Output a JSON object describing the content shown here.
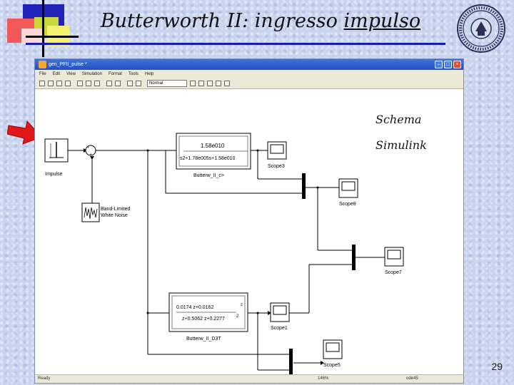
{
  "slide": {
    "title_prefix": "Butterworth II: ingresso ",
    "title_underlined": "impulso",
    "page_number": "29",
    "annotation_line1": "Schema",
    "annotation_line2": "Simulink"
  },
  "window": {
    "title": "gen_PFII_pulse *",
    "menu": [
      "File",
      "Edit",
      "View",
      "Simulation",
      "Format",
      "Tools",
      "Help"
    ],
    "mode_select": "Normal",
    "status": {
      "left": "Ready",
      "zoom": "146%",
      "solver": "ode45"
    }
  },
  "blocks": {
    "impulse": "Impulse",
    "noise_line1": "Band-Limited",
    "noise_line2": "White Noise",
    "tf1_num": "1.58e010",
    "tf1_den": "s2+1.78e005s+1.58e010",
    "tf1_label": "Butterw_II_c>",
    "tf2_num": "0.0174 z+0.0162",
    "tf2_num_exp": "z",
    "tf2_den": "z+0.5062 z+0.2277",
    "tf2_den_exp": "2",
    "tf2_label": "Butterw_II_D3T",
    "scope_a": "Scope3",
    "scope_b": "Scope8",
    "scope_c": "Scope7",
    "scope_d": "Scope1",
    "scope_e": "Scope5"
  },
  "colors": {
    "title_rule": "#1b1bb0",
    "titlebar": "#2150c0",
    "arrow": "#e01818"
  }
}
